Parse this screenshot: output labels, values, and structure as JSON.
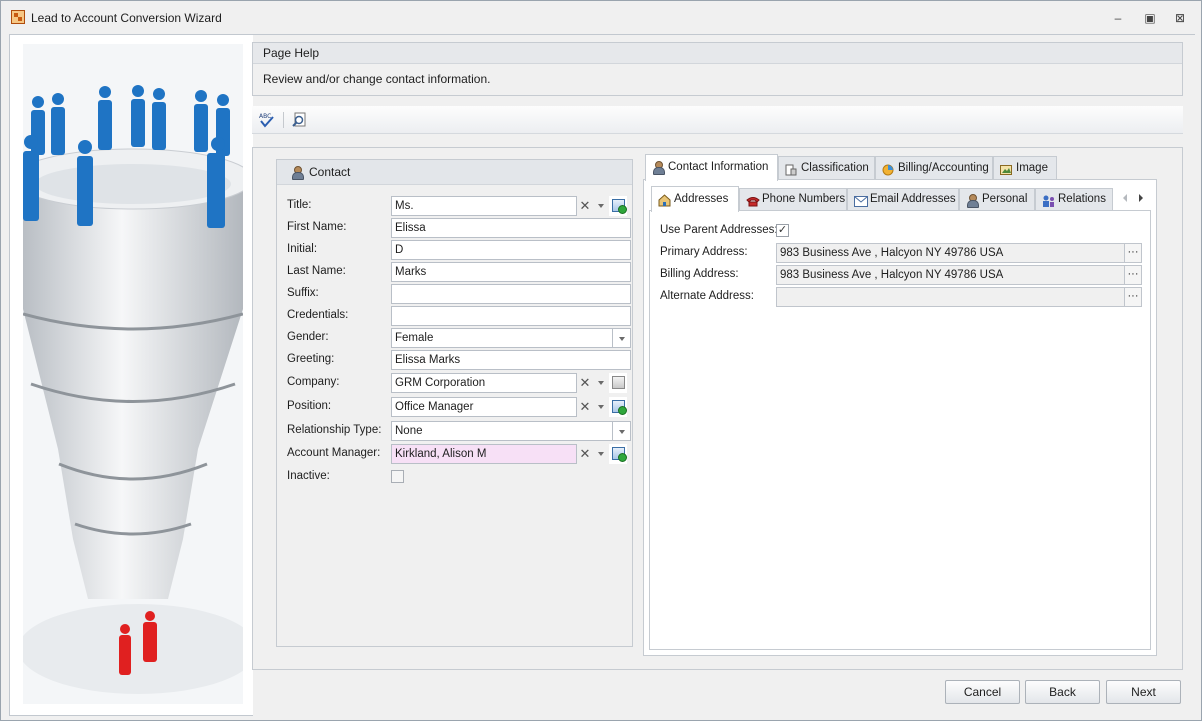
{
  "window": {
    "title": "Lead to Account Conversion Wizard",
    "controls": {
      "minimize": "‒",
      "restore": "▣",
      "close": "⊠"
    }
  },
  "page_help": {
    "header": "Page Help",
    "text": "Review and/or change contact information."
  },
  "toolbar": {
    "spellcheck_icon": "spellcheck-icon",
    "find_icon": "find-icon"
  },
  "contact": {
    "group_title": "Contact",
    "fields": {
      "title": {
        "label": "Title:",
        "value": "Ms."
      },
      "first_name": {
        "label": "First Name:",
        "value": "Elissa"
      },
      "initial": {
        "label": "Initial:",
        "value": "D"
      },
      "last_name": {
        "label": "Last Name:",
        "value": "Marks"
      },
      "suffix": {
        "label": "Suffix:",
        "value": ""
      },
      "credentials": {
        "label": "Credentials:",
        "value": ""
      },
      "gender": {
        "label": "Gender:",
        "value": "Female"
      },
      "greeting": {
        "label": "Greeting:",
        "value": "Elissa Marks"
      },
      "company": {
        "label": "Company:",
        "value": "GRM Corporation"
      },
      "position": {
        "label": "Position:",
        "value": "Office Manager"
      },
      "relationship_type": {
        "label": "Relationship Type:",
        "value": "None"
      },
      "account_manager": {
        "label": "Account Manager:",
        "value": "Kirkland, Alison M"
      },
      "inactive": {
        "label": "Inactive:",
        "checked": false
      }
    },
    "clear_glyph": "✕"
  },
  "tabs": {
    "primary": [
      {
        "label": "Contact Information",
        "active": true
      },
      {
        "label": "Classification",
        "active": false
      },
      {
        "label": "Billing/Accounting",
        "active": false
      },
      {
        "label": "Image",
        "active": false
      }
    ],
    "secondary": [
      {
        "label": "Addresses",
        "active": true
      },
      {
        "label": "Phone Numbers",
        "active": false
      },
      {
        "label": "Email Addresses",
        "active": false
      },
      {
        "label": "Personal",
        "active": false
      },
      {
        "label": "Relations",
        "active": false
      }
    ]
  },
  "addresses": {
    "use_parent": {
      "label": "Use Parent Addresses:",
      "checked": true,
      "check_glyph": "✓"
    },
    "primary": {
      "label": "Primary Address:",
      "value": "983 Business Ave , Halcyon NY 49786 USA"
    },
    "billing": {
      "label": "Billing Address:",
      "value": "983 Business Ave , Halcyon NY 49786 USA"
    },
    "alternate": {
      "label": "Alternate Address:",
      "value": ""
    },
    "ellipsis": "···"
  },
  "buttons": {
    "cancel": "Cancel",
    "back": "Back",
    "next": "Next"
  },
  "colors": {
    "accent_blue": "#1f74c4",
    "highlight_red": "#e02020",
    "required_field": "#f7e0f6"
  }
}
